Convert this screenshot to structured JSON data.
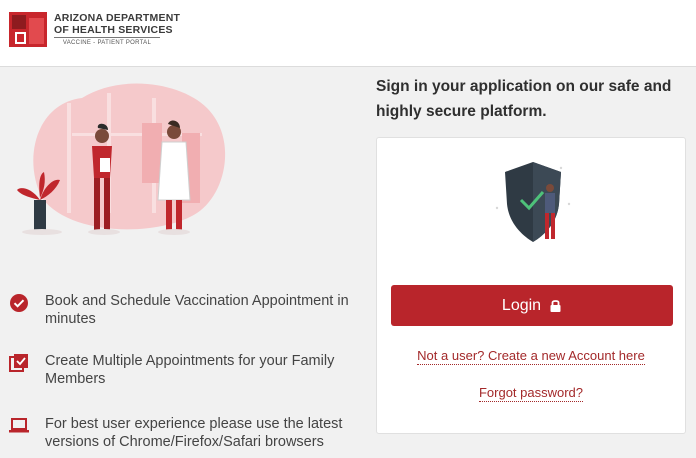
{
  "header": {
    "logo_line1": "ARIZONA DEPARTMENT",
    "logo_line2": "OF HEALTH SERVICES",
    "logo_sub": "VACCINE - PATIENT PORTAL"
  },
  "features": [
    {
      "icon": "check-circle-icon",
      "text": "Book and Schedule Vaccination Appointment in minutes"
    },
    {
      "icon": "checklist-icon",
      "text": "Create Multiple Appointments for your Family Members"
    },
    {
      "icon": "laptop-icon",
      "text": "For best user experience please use the latest versions of Chrome/Firefox/Safari browsers"
    }
  ],
  "signin": {
    "tagline": "Sign in your application on our safe and highly secure platform.",
    "login_label": "Login",
    "register_link": "Not a user? Create a new Account here",
    "forgot_link": "Forgot password?"
  },
  "colors": {
    "brand_red": "#b9252b",
    "link_red": "#a3292a",
    "background": "#f1f1f1"
  }
}
